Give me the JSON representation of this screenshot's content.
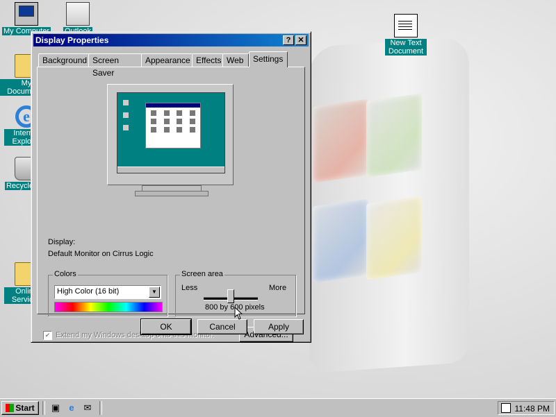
{
  "desktop": {
    "icons": [
      {
        "label": "My Computer",
        "icon": "computer-icon"
      },
      {
        "label": "Outlook",
        "icon": "outlook-icon"
      },
      {
        "label": "My Documents",
        "icon": "folder-icon"
      },
      {
        "label": "Internet Explorer",
        "icon": "internet-explorer-icon"
      },
      {
        "label": "Recycle Bin",
        "icon": "recycle-bin-icon"
      },
      {
        "label": "Online Services",
        "icon": "folder-icon"
      },
      {
        "label": "New Text Document",
        "icon": "text-document-icon"
      }
    ]
  },
  "dialog": {
    "title": "Display Properties",
    "help_button": "?",
    "close_button": "✕",
    "tabs": [
      "Background",
      "Screen Saver",
      "Appearance",
      "Effects",
      "Web",
      "Settings"
    ],
    "active_tab": "Settings",
    "display_label": "Display:",
    "display_value": "Default Monitor on Cirrus Logic",
    "colors": {
      "legend": "Colors",
      "selected": "High Color (16 bit)"
    },
    "screen_area": {
      "legend": "Screen area",
      "less": "Less",
      "more": "More",
      "value": "800 by 600 pixels",
      "slider_level": 0.5
    },
    "extend_checkbox": {
      "label": "Extend my Windows desktop onto this monitor.",
      "checked": true,
      "enabled": false
    },
    "advanced_button": "Advanced...",
    "ok_button": "OK",
    "cancel_button": "Cancel",
    "apply_button": "Apply"
  },
  "taskbar": {
    "start_label": "Start",
    "quick_launch": [
      "desktop-icon",
      "internet-explorer-icon",
      "outlook-icon"
    ],
    "clock": "11:48 PM"
  },
  "colors": {
    "desktop_teal": "#008080",
    "title_active": "#000080",
    "face": "#c0c0c0"
  }
}
